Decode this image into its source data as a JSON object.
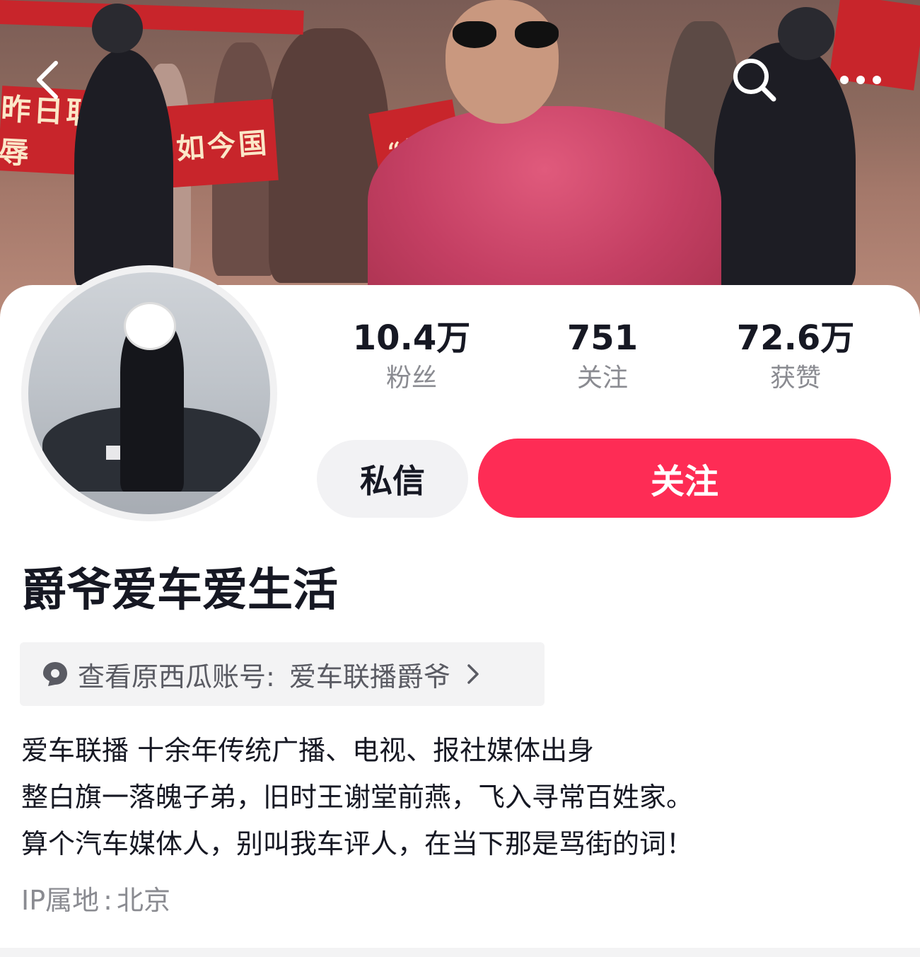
{
  "header": {
    "back_icon": "chevron-left-icon",
    "search_icon": "search-icon",
    "more_icon": "more-horizontal-icon",
    "cover_banners": [
      "",
      "昨日耻辱",
      "如今国",
      "“日”"
    ]
  },
  "profile": {
    "stats": [
      {
        "value": "10.4万",
        "label": "粉丝"
      },
      {
        "value": "751",
        "label": "关注"
      },
      {
        "value": "72.6万",
        "label": "获赞"
      }
    ],
    "message_button": "私信",
    "follow_button": "关注",
    "nickname": "爵爷爱车爱生活",
    "xigua_link": {
      "prefix": "查看原西瓜账号:",
      "account": "爱车联播爵爷",
      "icon": "xigua-icon",
      "chevron_icon": "chevron-right-icon"
    },
    "bio_lines": [
      "爱车联播 十余年传统广播、电视、报社媒体出身",
      "整白旗一落魄子弟，旧时王谢堂前燕，飞入寻常百姓家。",
      "算个汽车媒体人，别叫我车评人，在当下那是骂街的词！"
    ],
    "ip_label": "IP属地",
    "ip_separator": ":",
    "ip_location": "北京"
  },
  "colors": {
    "accent": "#fe2c55",
    "secondary_button": "#f2f2f4",
    "muted_text": "#8a8b91",
    "primary_text": "#161823"
  }
}
